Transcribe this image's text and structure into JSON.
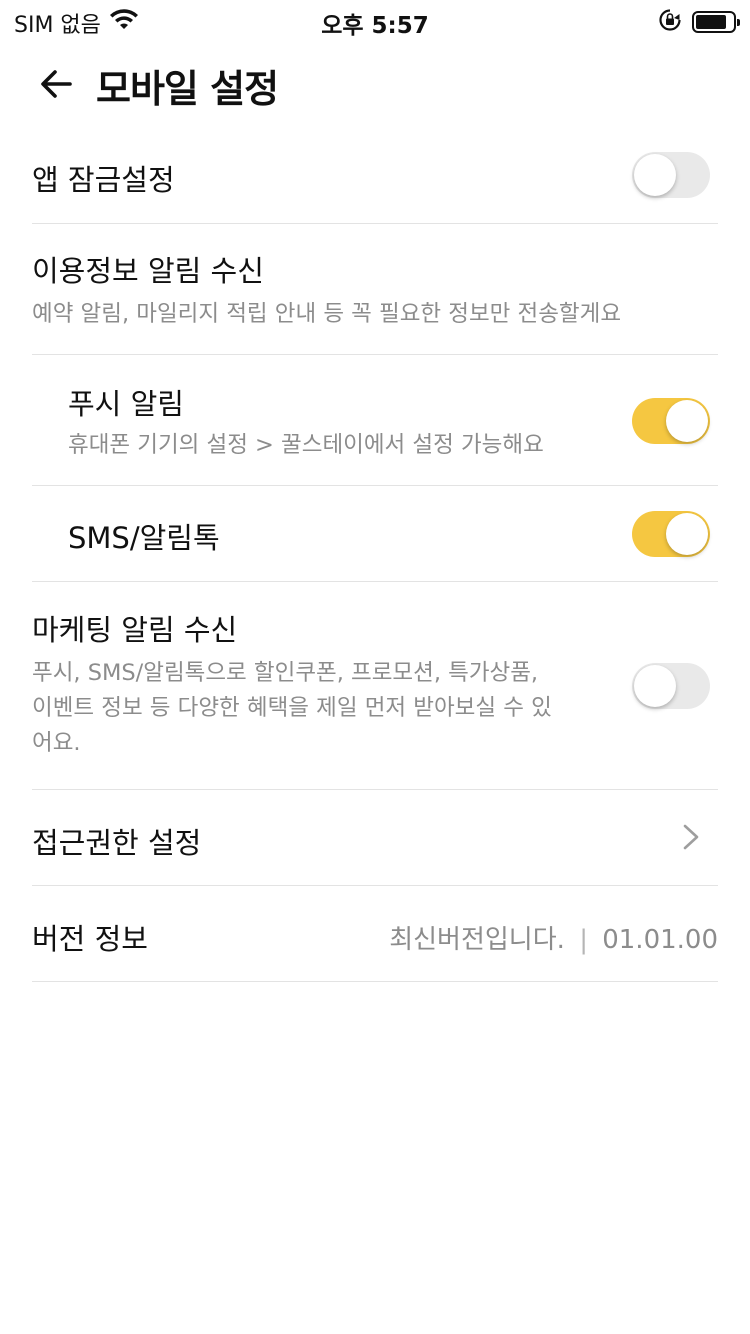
{
  "status_bar": {
    "carrier": "SIM 없음",
    "time": "오후 5:57"
  },
  "header": {
    "title": "모바일 설정"
  },
  "settings": {
    "app_lock": {
      "label": "앱 잠금설정",
      "enabled": false
    },
    "usage_notice": {
      "label": "이용정보 알림 수신",
      "description": "예약 알림, 마일리지 적립 안내 등 꼭 필요한 정보만 전송할게요"
    },
    "push": {
      "label": "푸시 알림",
      "description": "휴대폰 기기의 설정 > 꿀스테이에서 설정 가능해요",
      "enabled": true
    },
    "sms": {
      "label": "SMS/알림톡",
      "enabled": true
    },
    "marketing": {
      "label": "마케팅 알림 수신",
      "description_lines": [
        "푸시, SMS/알림톡으로 할인쿠폰, 프로모션, 특가상품,",
        "이벤트 정보 등 다양한 혜택을 제일 먼저 받아보실 수 있",
        "어요."
      ],
      "enabled": false
    },
    "permissions": {
      "label": "접근권한 설정"
    },
    "version": {
      "label": "버전 정보",
      "status": "최신버전입니다.",
      "separator": "|",
      "number": "01.01.00"
    }
  },
  "colors": {
    "toggle_on": "#f5c741",
    "toggle_off": "#e9e9e9",
    "divider": "#e3e3e3",
    "secondary_text": "#8c8c8c"
  },
  "icons": [
    "wifi-icon",
    "orientation-lock-icon",
    "battery-icon",
    "back-arrow-icon",
    "chevron-right-icon"
  ]
}
